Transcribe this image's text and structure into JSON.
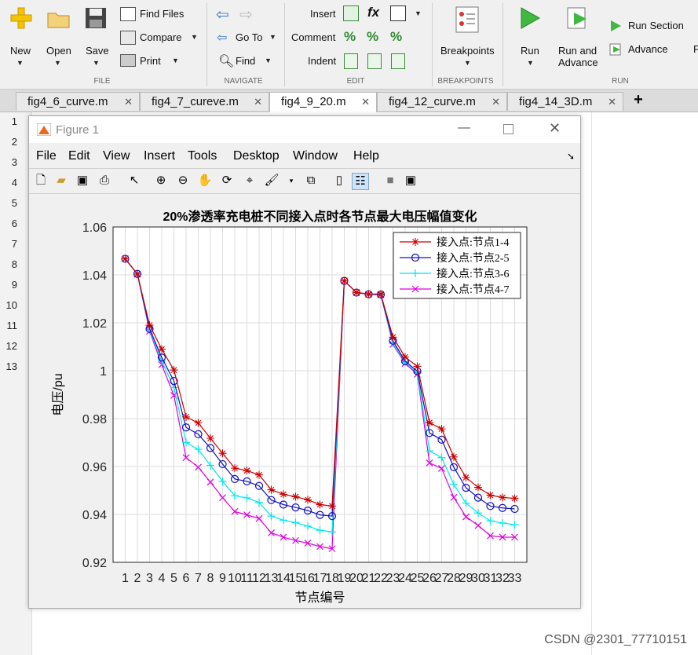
{
  "ribbon": {
    "file": {
      "new": "New",
      "open": "Open",
      "save": "Save",
      "find_files": "Find Files",
      "compare": "Compare",
      "print": "Print",
      "section": "FILE"
    },
    "navigate": {
      "go_to": "Go To",
      "find": "Find",
      "section": "NAVIGATE"
    },
    "edit": {
      "insert": "Insert",
      "comment": "Comment",
      "indent": "Indent",
      "section": "EDIT",
      "fx": "fx"
    },
    "breakpoints": {
      "label": "Breakpoints",
      "section": "BREAKPOINTS"
    },
    "run": {
      "run": "Run",
      "run_advance": "Run and Advance",
      "run_section": "Run Section",
      "advance": "Advance",
      "section": "RUN",
      "cut": "F"
    }
  },
  "tabs": [
    "fig4_6_curve.m",
    "fig4_7_cureve.m",
    "fig4_9_20.m",
    "fig4_12_curve.m",
    "fig4_14_3D.m"
  ],
  "add_tab": "+",
  "line_numbers": [
    "1",
    "2",
    "3",
    "4",
    "5",
    "6",
    "7",
    "8",
    "9",
    "10",
    "11",
    "12",
    "13"
  ],
  "editor_tail": ";",
  "figure": {
    "title": "Figure 1",
    "menus": [
      "File",
      "Edit",
      "View",
      "Insert",
      "Tools",
      "Desktop",
      "Window",
      "Help"
    ]
  },
  "chart_data": {
    "type": "line",
    "title": "20%渗透率充电桩不同接入点时各节点最大电压幅值变化",
    "xlabel": "节点编号",
    "ylabel": "电压/pu",
    "xlim": [
      0,
      34
    ],
    "ylim": [
      0.92,
      1.06
    ],
    "yticks": [
      "0.92",
      "0.94",
      "0.96",
      "0.98",
      "1",
      "1.02",
      "1.04",
      "1.06"
    ],
    "grid": true,
    "legend_position": "top-right",
    "x": [
      1,
      2,
      3,
      4,
      5,
      6,
      7,
      8,
      9,
      10,
      11,
      12,
      13,
      14,
      15,
      16,
      17,
      18,
      19,
      20,
      21,
      22,
      23,
      24,
      25,
      26,
      27,
      28,
      29,
      30,
      31,
      32,
      33
    ],
    "series": [
      {
        "name": "接入点:节点1-4",
        "color": "#cc0000",
        "marker": "*",
        "values": [
          1.0467,
          1.0404,
          1.019,
          1.009,
          1.0003,
          0.9807,
          0.9782,
          0.9718,
          0.9655,
          0.9593,
          0.9583,
          0.9565,
          0.9503,
          0.9484,
          0.9474,
          0.9461,
          0.9441,
          0.9435,
          1.0375,
          1.0327,
          1.032,
          1.032,
          1.014,
          1.0057,
          1.0018,
          0.9783,
          0.9757,
          0.964,
          0.9554,
          0.9513,
          0.948,
          0.9471,
          0.9467
        ]
      },
      {
        "name": "接入点:节点2-5",
        "color": "#1010c0",
        "marker": "o",
        "values": [
          1.0467,
          1.0404,
          1.0175,
          1.0055,
          0.9957,
          0.9763,
          0.9735,
          0.9677,
          0.961,
          0.9548,
          0.9538,
          0.9519,
          0.946,
          0.9441,
          0.9429,
          0.9416,
          0.9398,
          0.9393,
          1.0375,
          1.0326,
          1.0319,
          1.0318,
          1.0125,
          1.004,
          0.9998,
          0.974,
          0.9712,
          0.9597,
          0.9511,
          0.947,
          0.9435,
          0.9427,
          0.9423
        ]
      },
      {
        "name": "接入点:节点3-6",
        "color": "#00e8e8",
        "marker": "+",
        "values": [
          1.0467,
          1.0403,
          1.017,
          1.004,
          0.993,
          0.97,
          0.9672,
          0.9605,
          0.9538,
          0.9478,
          0.9469,
          0.945,
          0.9393,
          0.9376,
          0.9366,
          0.9351,
          0.9334,
          0.9327,
          1.0375,
          1.0326,
          1.0319,
          1.0317,
          1.0115,
          1.0035,
          0.999,
          0.9665,
          0.9637,
          0.9525,
          0.9447,
          0.9406,
          0.9373,
          0.9364,
          0.9357
        ]
      },
      {
        "name": "接入点:节点4-7",
        "color": "#dd00dd",
        "marker": "x",
        "values": [
          1.0467,
          1.0403,
          1.0165,
          1.0025,
          0.9897,
          0.9637,
          0.9597,
          0.9535,
          0.947,
          0.9412,
          0.9398,
          0.9383,
          0.9323,
          0.9305,
          0.9291,
          0.928,
          0.9266,
          0.9257,
          1.0375,
          1.0326,
          1.0319,
          1.0317,
          1.011,
          1.003,
          0.9985,
          0.9615,
          0.9592,
          0.9471,
          0.939,
          0.9354,
          0.9311,
          0.9305,
          0.9305
        ]
      }
    ]
  },
  "watermark": "CSDN @2301_77710151"
}
